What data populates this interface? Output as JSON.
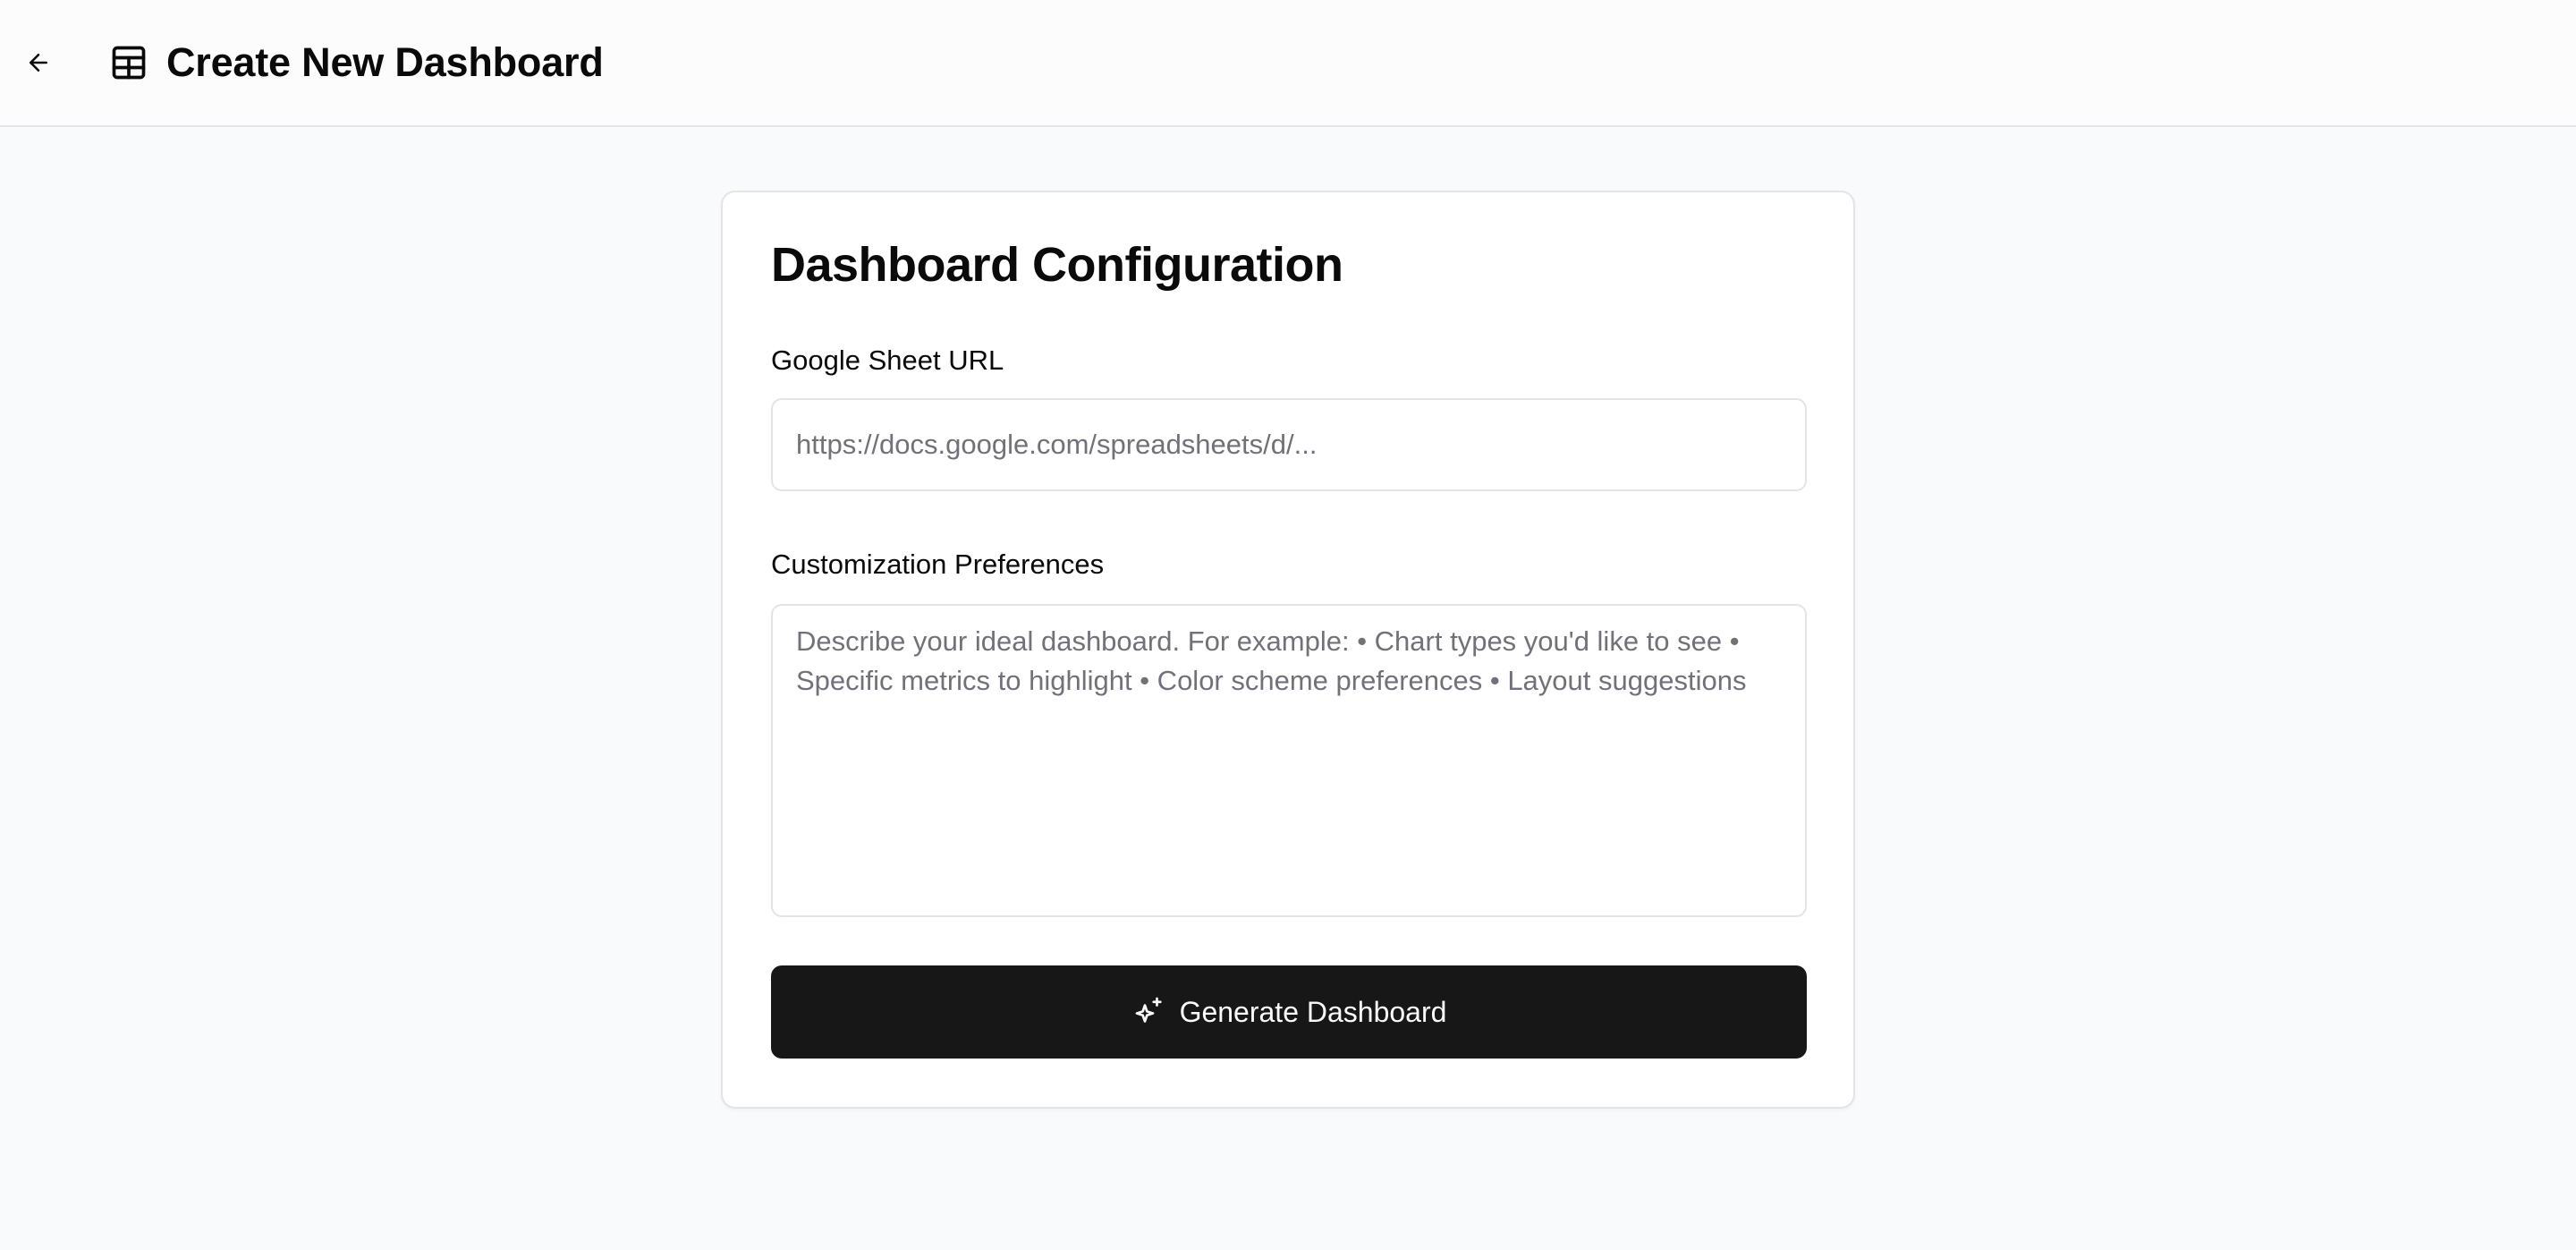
{
  "header": {
    "back_icon": "arrow-left-icon",
    "title_icon": "table-icon",
    "title": "Create New Dashboard"
  },
  "card": {
    "title": "Dashboard Configuration",
    "url_field": {
      "label": "Google Sheet URL",
      "value": "",
      "placeholder": "https://docs.google.com/spreadsheets/d/..."
    },
    "preferences_field": {
      "label": "Customization Preferences",
      "value": "",
      "placeholder": "Describe your ideal dashboard. For example: • Chart types you'd like to see • Specific metrics to highlight • Color scheme preferences • Layout suggestions"
    },
    "generate_button": {
      "icon": "sparkles-icon",
      "label": "Generate Dashboard"
    }
  },
  "colors": {
    "page_background": "#f8fafc",
    "header_background": "#fcfcfc",
    "card_background": "#ffffff",
    "border": "#e4e4e7",
    "primary_button": "#171717",
    "primary_button_text": "#fafafa",
    "placeholder_text": "#71717a"
  }
}
